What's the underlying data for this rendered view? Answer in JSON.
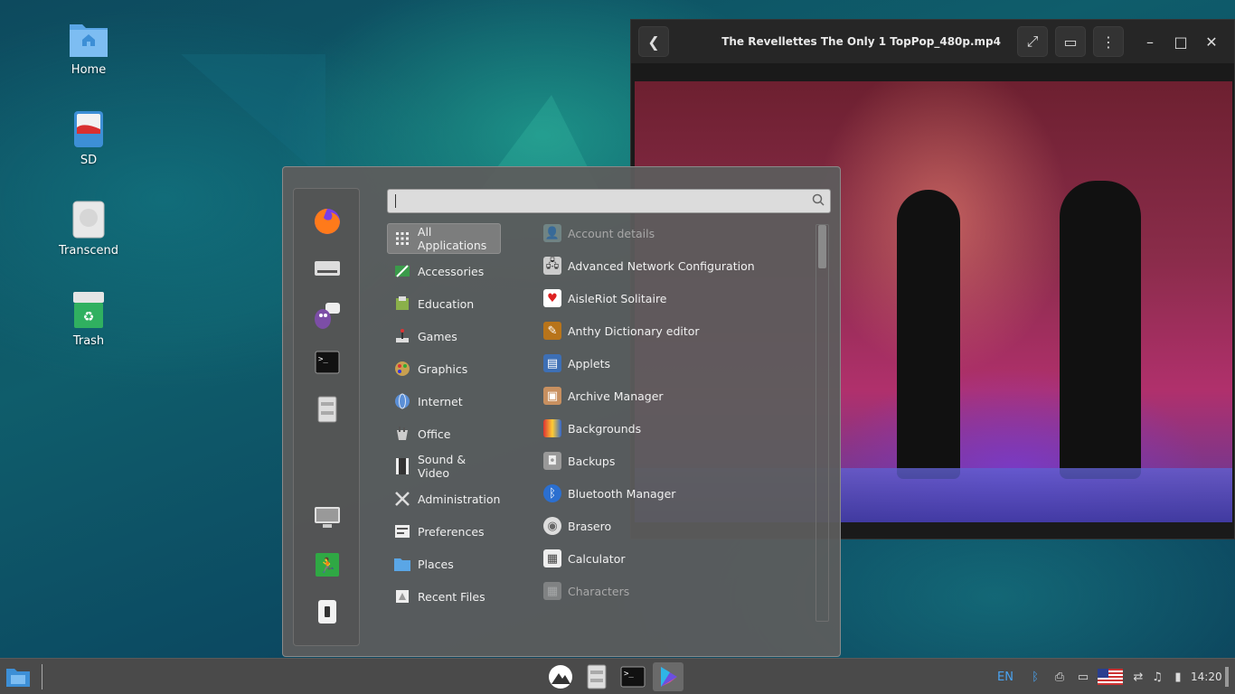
{
  "desktop": {
    "icons": [
      {
        "label": "Home",
        "icon": "folder-home-icon"
      },
      {
        "label": "SD",
        "icon": "sd-card-icon"
      },
      {
        "label": "Transcend",
        "icon": "drive-icon"
      },
      {
        "label": "Trash",
        "icon": "trash-icon"
      }
    ]
  },
  "video_player": {
    "title": "The Revellettes  The Only 1  TopPop_480p.mp4",
    "buttons": [
      "back",
      "fullscreen",
      "subtitles",
      "menu",
      "minimize",
      "maximize",
      "close"
    ]
  },
  "menu": {
    "search": {
      "value": "",
      "placeholder": ""
    },
    "favorites": [
      "firefox-icon",
      "drive-manager-icon",
      "pidgin-icon",
      "terminal-icon",
      "file-cabinet-icon"
    ],
    "session": [
      "lock-screen-icon",
      "logout-icon",
      "shutdown-icon"
    ],
    "categories": [
      {
        "label": "All Applications",
        "active": true
      },
      {
        "label": "Accessories"
      },
      {
        "label": "Education"
      },
      {
        "label": "Games"
      },
      {
        "label": "Graphics"
      },
      {
        "label": "Internet"
      },
      {
        "label": "Office"
      },
      {
        "label": "Sound & Video"
      },
      {
        "label": "Administration"
      },
      {
        "label": "Preferences"
      },
      {
        "label": "Places"
      },
      {
        "label": "Recent Files"
      }
    ],
    "apps": [
      {
        "label": "Account details",
        "dim": true
      },
      {
        "label": "Advanced Network Configuration"
      },
      {
        "label": "AisleRiot Solitaire"
      },
      {
        "label": "Anthy Dictionary editor"
      },
      {
        "label": "Applets"
      },
      {
        "label": "Archive Manager"
      },
      {
        "label": "Backgrounds"
      },
      {
        "label": "Backups"
      },
      {
        "label": "Bluetooth Manager"
      },
      {
        "label": "Brasero"
      },
      {
        "label": "Calculator"
      },
      {
        "label": "Characters",
        "dim": true
      }
    ]
  },
  "taskbar": {
    "language": "EN",
    "time": "14:20"
  },
  "colors": {
    "menu_bg": "#5c5c5c",
    "taskbar_bg": "#4a4a4a",
    "accent": "#3d8fd6"
  }
}
